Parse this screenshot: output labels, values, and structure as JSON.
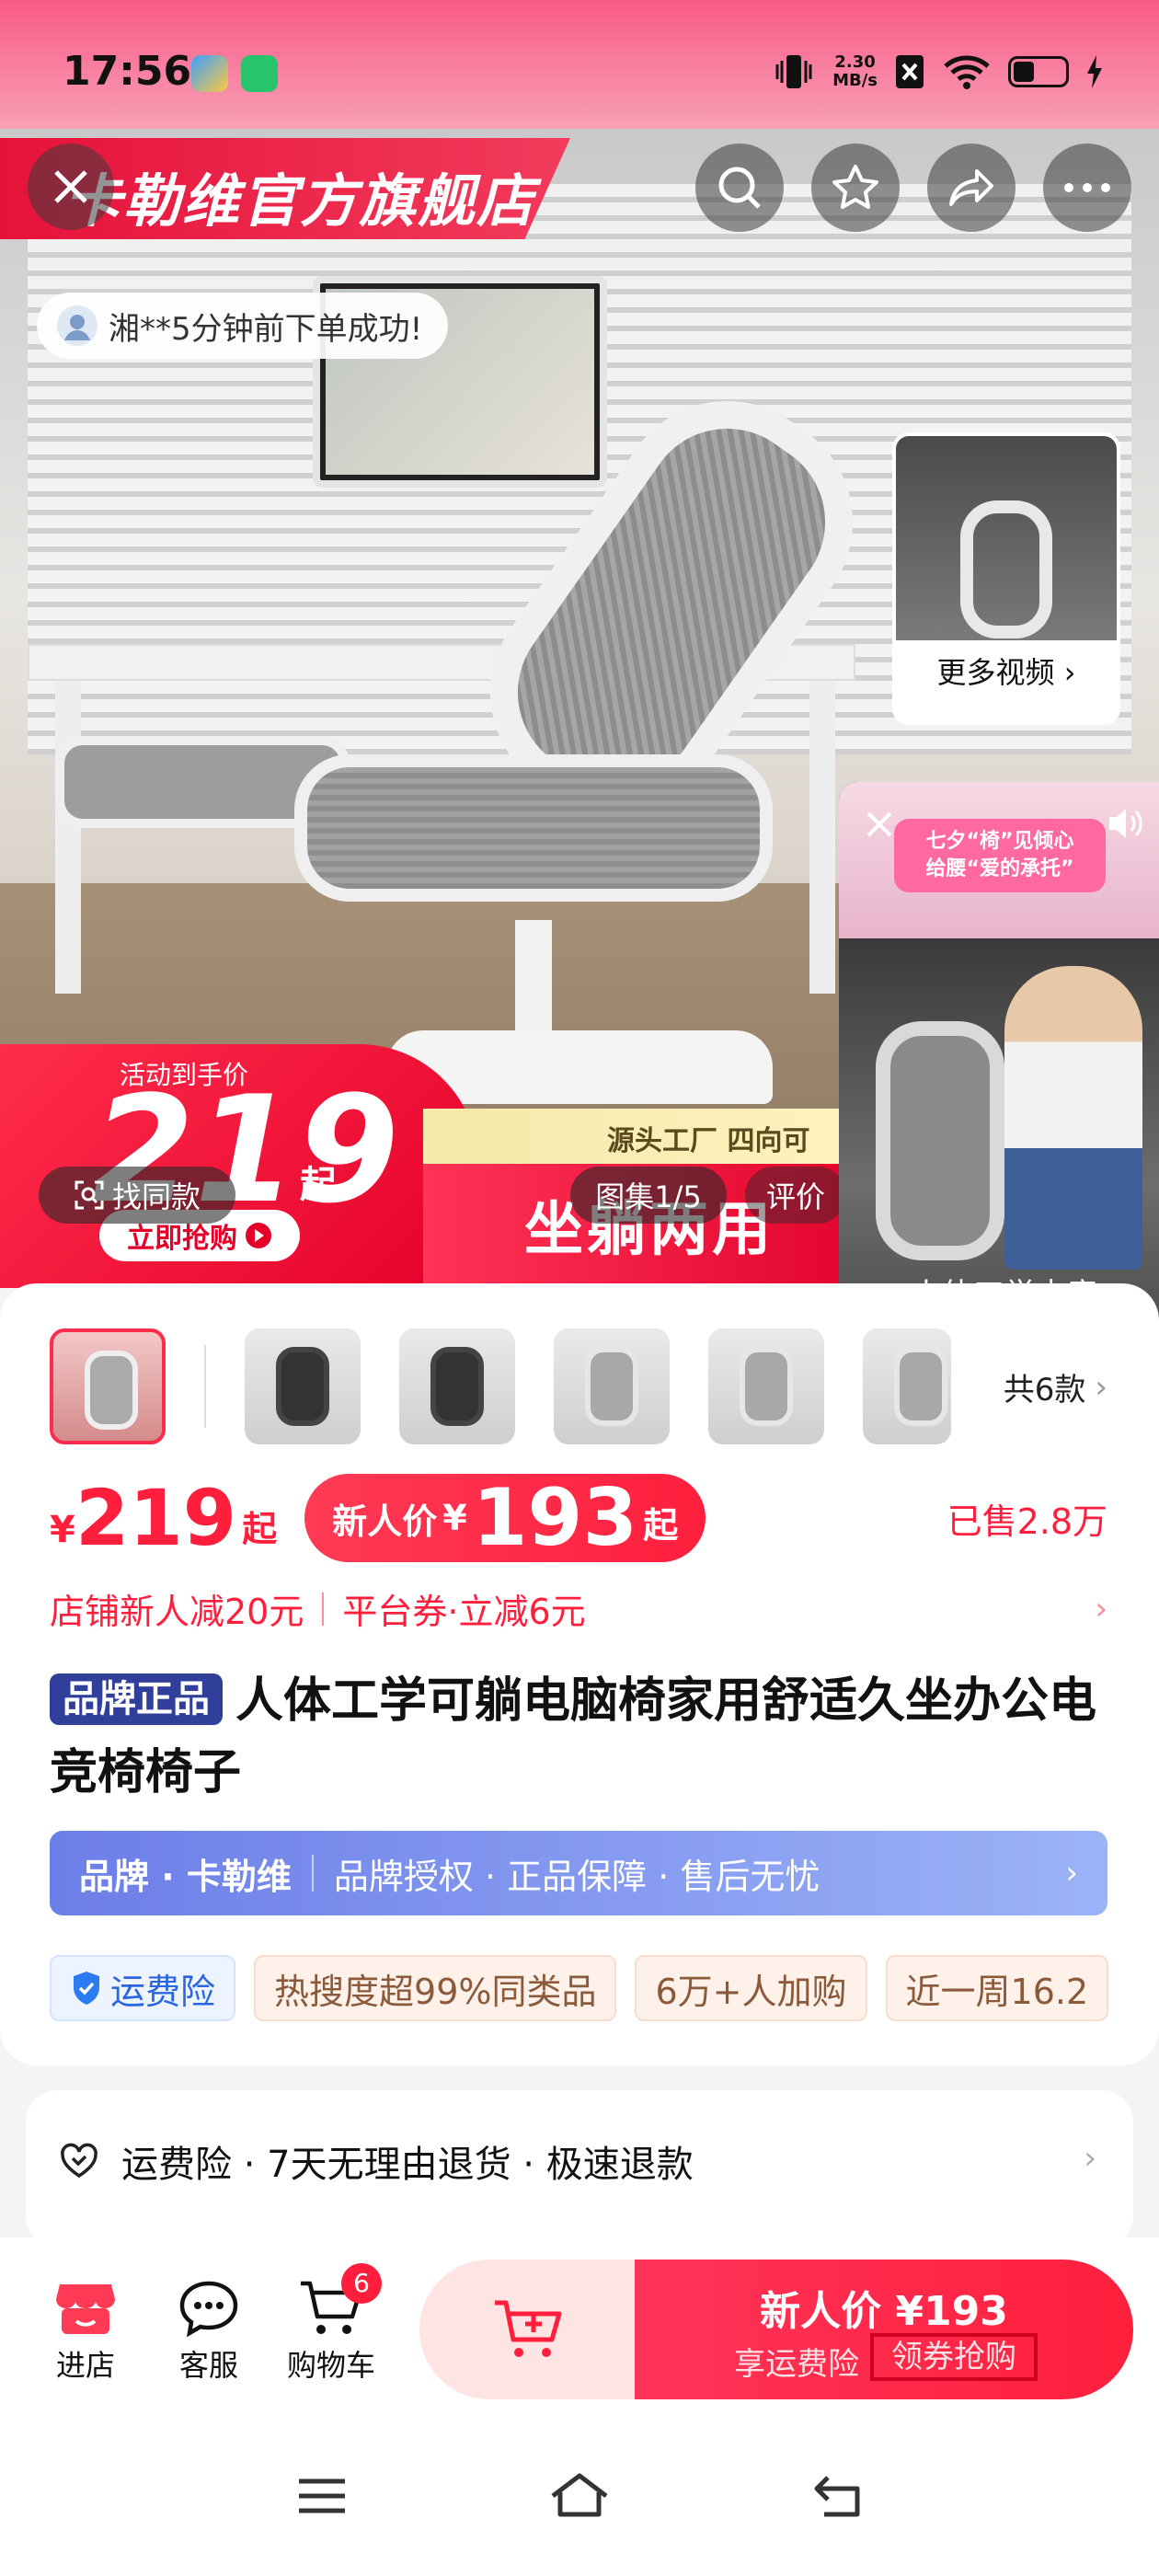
{
  "status_bar": {
    "time": "17:56",
    "net_speed_value": "2.30",
    "net_speed_unit": "MB/s"
  },
  "hero": {
    "store_name": "卡勒维官方旗舰店",
    "order_toast": "湘**5分钟前下单成功!",
    "more_videos": "更多视频",
    "price_badge": {
      "label": "活动到手价",
      "price": "219",
      "suffix": "起",
      "cta": "立即抢购"
    },
    "factory_text": "源头工厂 四向可",
    "slogan": "坐躺两用",
    "find_similar": "找同款",
    "gallery_counter": "图集1/5",
    "reviews_tab": "评价",
    "live_video": {
      "promo_line1": "七夕“椅”见倾心",
      "promo_line2": "给腰“爱的承托”",
      "caption": "人体工学电竞"
    }
  },
  "variants": {
    "count_label": "共6款"
  },
  "pricing": {
    "currency": "¥",
    "price": "219",
    "suffix": "起",
    "newbie_label": "新人价",
    "newbie_currency": "¥",
    "newbie_price": "193",
    "newbie_suffix": "起",
    "sold": "已售2.8万"
  },
  "promos": {
    "shop_discount": "店铺新人减20元",
    "platform_coupon": "平台券·立减6元"
  },
  "product": {
    "badge": "品牌正品",
    "title": "人体工学可躺电脑椅家用舒适久坐办公电竞椅椅子"
  },
  "brand_bar": {
    "brand": "品牌 · 卡勒维",
    "guarantees": "品牌授权 · 正品保障 · 售后无忧"
  },
  "tags": [
    "运费险",
    "热搜度超99%同类品",
    "6万+人加购",
    "近一周16.2"
  ],
  "service": {
    "text": "运费险 · 7天无理由退货 · 极速退款"
  },
  "bottom_bar": {
    "store": "进店",
    "service": "客服",
    "cart": "购物车",
    "cart_count": "6",
    "buy_line1": "新人价 ¥193",
    "buy_line2_a": "享运费险",
    "buy_line2_b": "领券抢购"
  },
  "colors": {
    "accent": "#ff1f3d",
    "brand_bar": "#6c7ee8",
    "title_badge": "#2f3f9a"
  }
}
